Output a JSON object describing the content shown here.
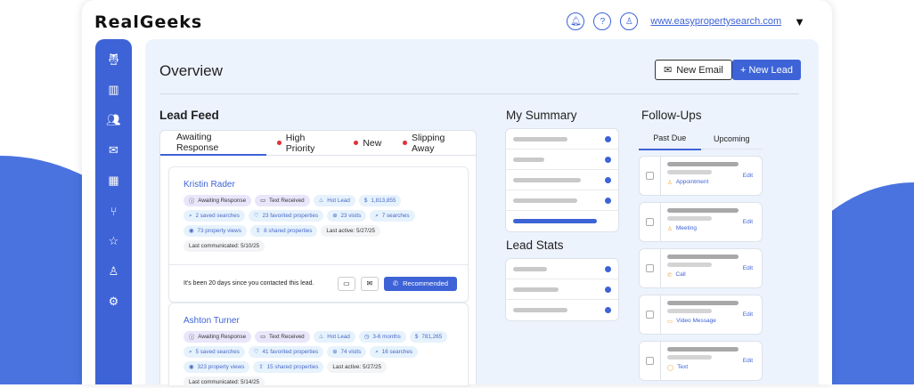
{
  "app": {
    "logo": "RealGeeks",
    "site": "www.easypropertysearch.com"
  },
  "header": {
    "title": "Overview",
    "new_email": "New Email",
    "new_lead": "+ New Lead"
  },
  "lead_feed": {
    "title": "Lead Feed",
    "tabs": [
      "Awaiting Response",
      "High Priority",
      "New",
      "Slipping Away"
    ],
    "leads": [
      {
        "name": "Kristin Rader",
        "chips": [
          [
            "Awaiting Response",
            "p",
            "ⓘ"
          ],
          [
            "Text Received",
            "p",
            "▭"
          ],
          [
            "Hot Lead",
            "b",
            "♨"
          ],
          [
            "1,813,855",
            "b",
            "$"
          ],
          [
            "2 saved searches",
            "b",
            "⌕"
          ],
          [
            "23 favorited properties",
            "b",
            "♡"
          ],
          [
            "23 visits",
            "b",
            "⊕"
          ],
          [
            "7 searches",
            "b",
            "⌕"
          ],
          [
            "73 property views",
            "b",
            "◉"
          ],
          [
            "8 shared properties",
            "b",
            "⇪"
          ],
          [
            "Last active: 5/27/25",
            "g",
            ""
          ],
          [
            "Last communicated: 5/10/25",
            "g",
            ""
          ]
        ],
        "footer": "It's been 20 days since you contacted this lead.",
        "recommended": "Recommended"
      },
      {
        "name": "Ashton Turner",
        "chips": [
          [
            "Awaiting Response",
            "p",
            "ⓘ"
          ],
          [
            "Text Received",
            "p",
            "▭"
          ],
          [
            "Hot Lead",
            "b",
            "♨"
          ],
          [
            "3-6 months",
            "b",
            "◷"
          ],
          [
            "781,265",
            "b",
            "$"
          ],
          [
            "5 saved searches",
            "b",
            "⌕"
          ],
          [
            "41 favorited properties",
            "b",
            "♡"
          ],
          [
            "74 visits",
            "b",
            "⊕"
          ],
          [
            "16 searches",
            "b",
            "⌕"
          ],
          [
            "323 property views",
            "b",
            "◉"
          ],
          [
            "15 shared properties",
            "b",
            "⇪"
          ],
          [
            "Last active: 5/27/25",
            "g",
            ""
          ],
          [
            "Last communicated: 5/14/25",
            "g",
            ""
          ]
        ]
      }
    ]
  },
  "summary": {
    "title": "My Summary"
  },
  "lead_stats": {
    "title": "Lead Stats"
  },
  "follow_ups": {
    "title": "Follow-Ups",
    "tabs": [
      "Past Due",
      "Upcoming"
    ],
    "edit": "Edit",
    "items": [
      {
        "type": "Appointment",
        "icon": "♙"
      },
      {
        "type": "Meeting",
        "icon": "♙"
      },
      {
        "type": "Call",
        "icon": "✆"
      },
      {
        "type": "Video Message",
        "icon": "▭"
      },
      {
        "type": "Text",
        "icon": "◯"
      }
    ]
  },
  "colors": {
    "accent": "#3d63d6",
    "bg": "#edf3fd"
  }
}
